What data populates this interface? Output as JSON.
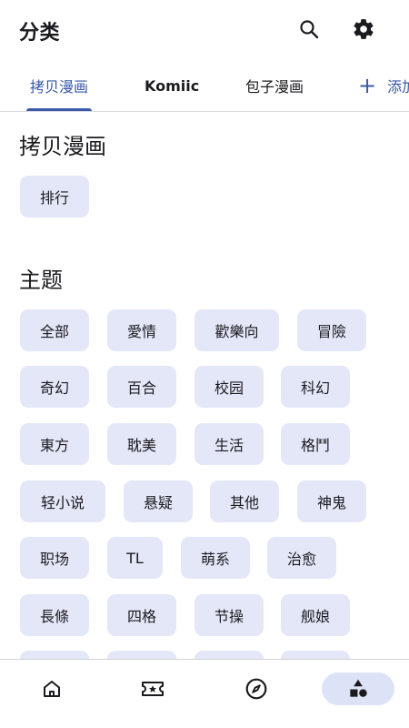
{
  "appbar": {
    "title": "分类",
    "search_icon": "search-icon",
    "settings_icon": "gear-icon"
  },
  "tabs": [
    {
      "label": "拷贝漫画",
      "active": true
    },
    {
      "label": "Komiic",
      "active": false
    },
    {
      "label": "包子漫画",
      "active": false
    },
    {
      "label": "添加",
      "active": false,
      "icon": "plus-icon"
    }
  ],
  "sections": [
    {
      "title": "拷贝漫画",
      "chips": [
        "排行"
      ]
    },
    {
      "title": "主题",
      "chips": [
        "全部",
        "愛情",
        "歡樂向",
        "冒險",
        "奇幻",
        "百合",
        "校园",
        "科幻",
        "東方",
        "耽美",
        "生活",
        "格鬥",
        "轻小说",
        "悬疑",
        "其他",
        "神鬼",
        "职场",
        "TL",
        "萌系",
        "治愈",
        "長條",
        "四格",
        "节操",
        "舰娘"
      ]
    }
  ],
  "bottom_nav": [
    {
      "icon": "home-icon",
      "active": false
    },
    {
      "icon": "ticket-star-icon",
      "active": false
    },
    {
      "icon": "compass-icon",
      "active": false
    },
    {
      "icon": "shapes-icon",
      "active": true
    }
  ],
  "colors": {
    "accent": "#3b59a8",
    "chip_bg": "#e3e7f8",
    "nav_active_bg": "#dde3f7"
  }
}
